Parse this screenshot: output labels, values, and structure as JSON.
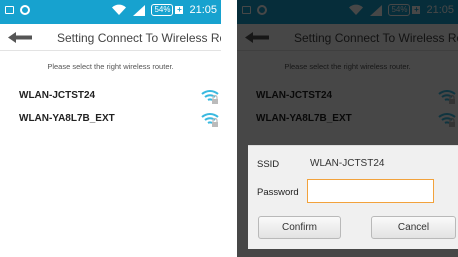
{
  "status_bar": {
    "time": "21:05",
    "battery": "54%",
    "icons": [
      "screenshot-icon",
      "sync-icon",
      "wifi-icon",
      "signal-icon",
      "battery-icon"
    ]
  },
  "header": {
    "title": "Setting Connect To Wireless Router",
    "back_icon": "back-arrow-icon"
  },
  "instruction": "Please select the right wireless router.",
  "networks": [
    {
      "ssid": "WLAN-JCTST24",
      "icon": "wifi-locked-icon"
    },
    {
      "ssid": "WLAN-YA8L7B_EXT",
      "icon": "wifi-locked-icon"
    }
  ],
  "dialog": {
    "ssid_label": "SSID",
    "ssid_value": "WLAN-JCTST24",
    "password_label": "Password",
    "password_value": "",
    "confirm_label": "Confirm",
    "cancel_label": "Cancel"
  },
  "colors": {
    "status_bar": "#17a2cf",
    "wifi_icon": "#3ab9e0",
    "input_border": "#f2a23c"
  }
}
